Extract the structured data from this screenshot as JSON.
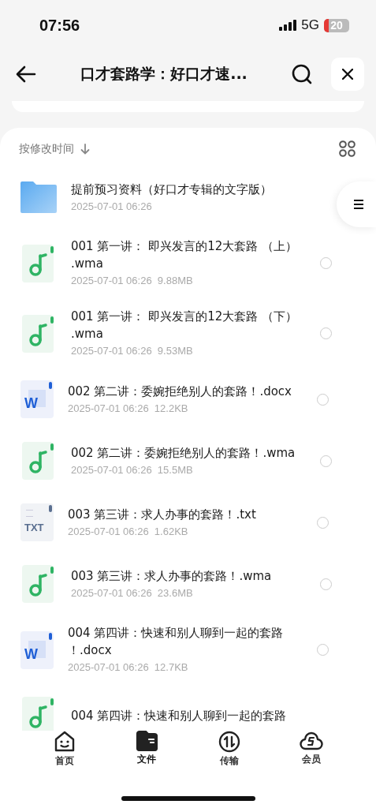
{
  "status_bar": {
    "time": "07:56",
    "network": "5G",
    "battery": "20"
  },
  "header": {
    "title": "口才套路学：好口才速..."
  },
  "sort": {
    "label": "按修改时间"
  },
  "files": [
    {
      "kind": "folder",
      "name": "提前预习资料（好口才专辑的文字版）",
      "meta": "2025-07-01 06:26"
    },
    {
      "kind": "audio",
      "name": "001 第一讲： 即兴发言的12大套路 （上）.wma",
      "meta": "2025-07-01 06:26  9.88MB",
      "selected": false
    },
    {
      "kind": "audio",
      "name": "001 第一讲： 即兴发言的12大套路 （下）.wma",
      "meta": "2025-07-01 06:26  9.53MB",
      "selected": false
    },
    {
      "kind": "doc",
      "icon_text": "W",
      "name": "002 第二讲：委婉拒绝别人的套路！.docx",
      "meta": "2025-07-01 06:26  12.2KB",
      "selected": false
    },
    {
      "kind": "audio",
      "name": "002 第二讲：委婉拒绝别人的套路！.wma",
      "meta": "2025-07-01 06:26  15.5MB",
      "selected": false
    },
    {
      "kind": "txt",
      "icon_text": "TXT",
      "name": "003 第三讲：求人办事的套路！.txt",
      "meta": "2025-07-01 06:26  1.62KB",
      "selected": false
    },
    {
      "kind": "audio",
      "name": "003 第三讲：求人办事的套路！.wma",
      "meta": "2025-07-01 06:26  23.6MB",
      "selected": false
    },
    {
      "kind": "doc",
      "icon_text": "W",
      "name": "004 第四讲：快速和别人聊到一起的套路！.docx",
      "meta": "2025-07-01 06:26  12.7KB",
      "selected": false
    },
    {
      "kind": "audio",
      "name": "004 第四讲：快速和别人聊到一起的套路"
    }
  ],
  "tabs": [
    {
      "kind": "home",
      "label": "首页",
      "selected": false
    },
    {
      "kind": "files",
      "label": "文件",
      "selected": true
    },
    {
      "kind": "transfer",
      "label": "传输",
      "selected": false
    },
    {
      "kind": "member",
      "label": "会员",
      "selected": false
    }
  ]
}
